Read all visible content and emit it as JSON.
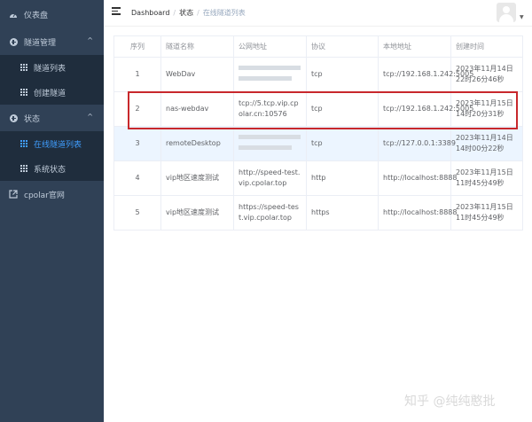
{
  "sidebar": {
    "items": [
      {
        "label": "仪表盘",
        "icon": "dashboard-icon"
      },
      {
        "label": "隧道管理",
        "icon": "plus-circle-icon"
      },
      {
        "label": "隧道列表",
        "icon": "grid-icon"
      },
      {
        "label": "创建隧道",
        "icon": "grid-icon"
      },
      {
        "label": "状态",
        "icon": "plus-circle-icon"
      },
      {
        "label": "在线隧道列表",
        "icon": "grid-icon"
      },
      {
        "label": "系统状态",
        "icon": "grid-icon"
      },
      {
        "label": "cpolar官网",
        "icon": "external-link-icon"
      }
    ]
  },
  "header": {
    "breadcrumb": [
      "Dashboard",
      "状态",
      "在线隧道列表"
    ]
  },
  "table": {
    "columns": [
      "序列",
      "隧道名称",
      "公网地址",
      "协议",
      "本地地址",
      "创建时间"
    ],
    "rows": [
      {
        "index": "1",
        "name": "WebDav",
        "public": "",
        "protocol": "tcp",
        "local": "tcp://192.168.1.242:5005",
        "created": "2023年11月14日 22时26分46秒"
      },
      {
        "index": "2",
        "name": "nas-webdav",
        "public": "tcp://5.tcp.vip.cpolar.cn:10576",
        "protocol": "tcp",
        "local": "tcp://192.168.1.242:5005",
        "created": "2023年11月15日 14时20分31秒"
      },
      {
        "index": "3",
        "name": "remoteDesktop",
        "public": "",
        "protocol": "tcp",
        "local": "tcp://127.0.0.1:3389",
        "created": "2023年11月14日 14时00分22秒"
      },
      {
        "index": "4",
        "name": "vip地区速度测试",
        "public": "http://speed-test.vip.cpolar.top",
        "protocol": "http",
        "local": "http://localhost:8888",
        "created": "2023年11月15日 11时45分49秒"
      },
      {
        "index": "5",
        "name": "vip地区速度测试",
        "public": "https://speed-test.vip.cpolar.top",
        "protocol": "https",
        "local": "http://localhost:8888",
        "created": "2023年11月15日 11时45分49秒"
      }
    ]
  },
  "watermark": "知乎 @纯纯憨批",
  "colors": {
    "sidebar_bg": "#304156",
    "active": "#409eff",
    "highlight_row": "#ecf5ff",
    "annotation_box": "#c8282c"
  }
}
